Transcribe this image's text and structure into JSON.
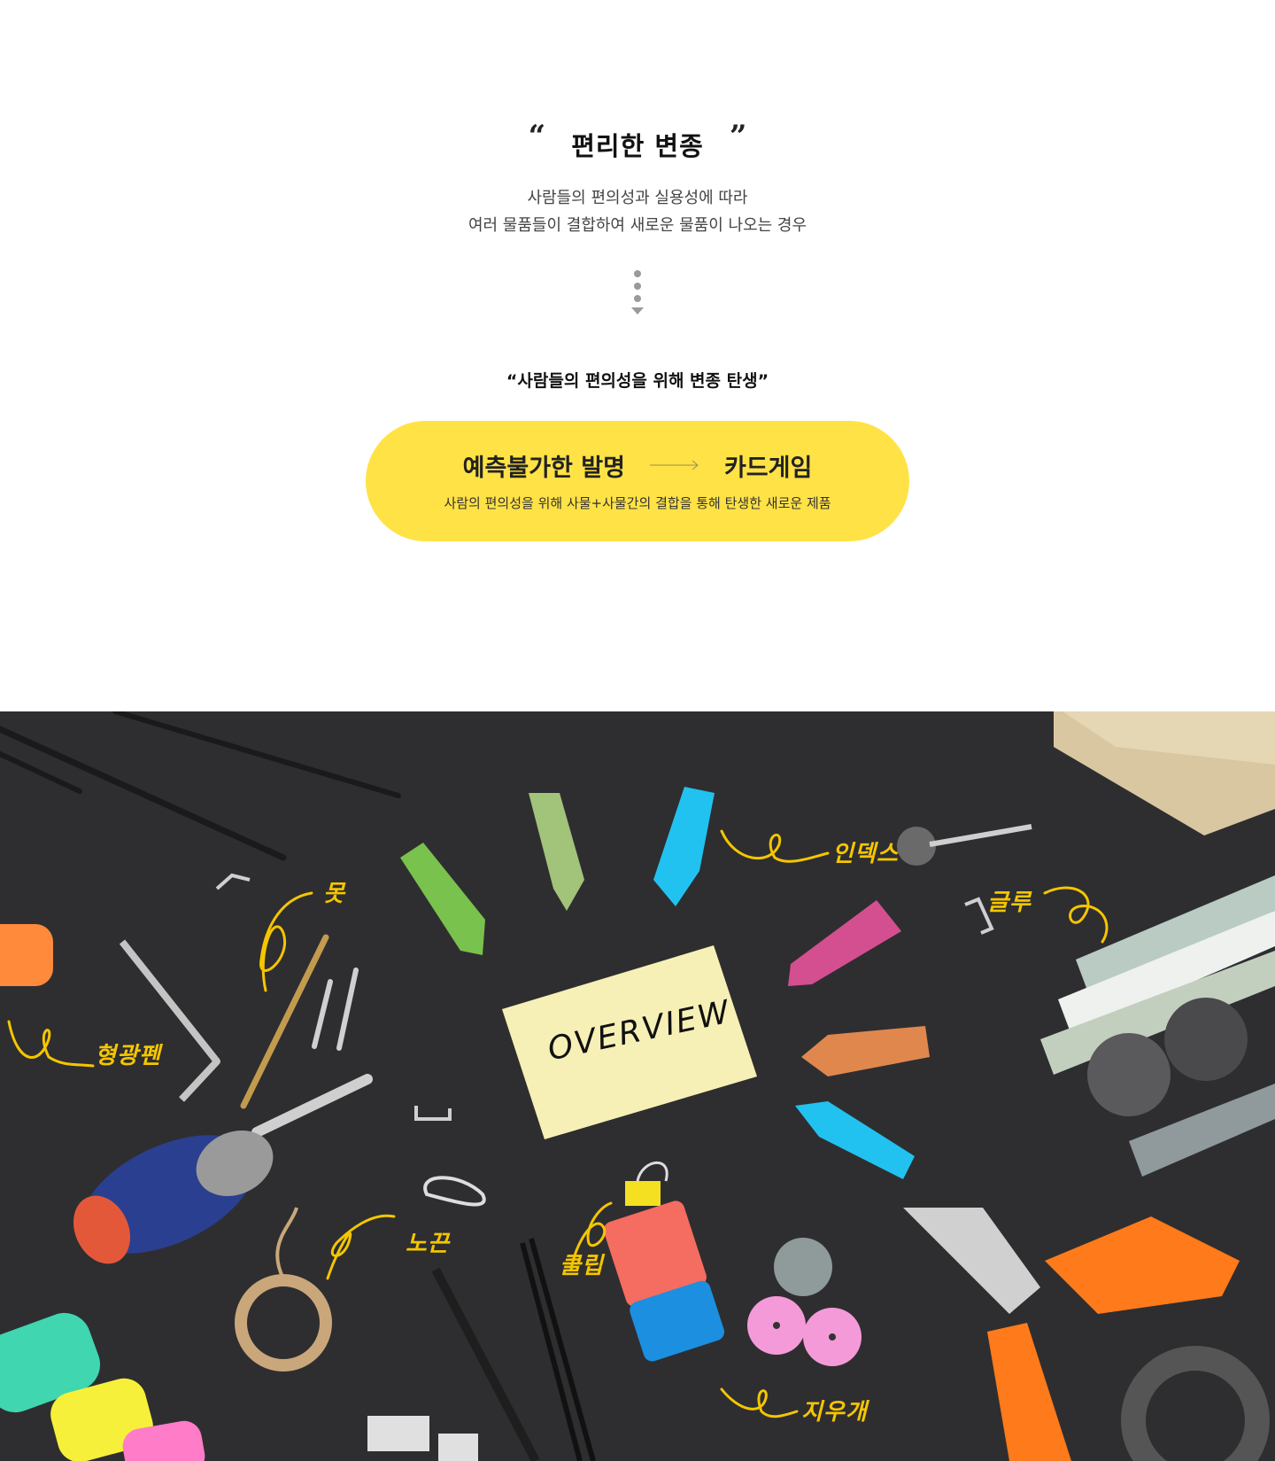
{
  "intro": {
    "open_quote": "“",
    "title": "편리한 변종",
    "close_quote": "”",
    "desc_line1": "사람들의 편의성과 실용성에 따라",
    "desc_line2": "여러 물품들이 결합하여 새로운 물품이 나오는 경우"
  },
  "tagline": "“사람들의 편의성을 위해 변종 탄생”",
  "highlight": {
    "left": "예측불가한 발명",
    "right": "카드게임",
    "sub": "사람의 편의성을 위해 사물+사물간의 결합을 통해 탄생한 새로운 제품"
  },
  "photo": {
    "card_text": "OVERVIEW",
    "labels": {
      "nail": "못",
      "index": "인덱스",
      "glue": "글루",
      "highlighter": "형광펜",
      "string": "노끈",
      "clip": "클립",
      "eraser": "지우개"
    }
  },
  "colors": {
    "accent": "#ffe246",
    "label": "#f5c600",
    "photo_bg": "#2d2d2f"
  }
}
